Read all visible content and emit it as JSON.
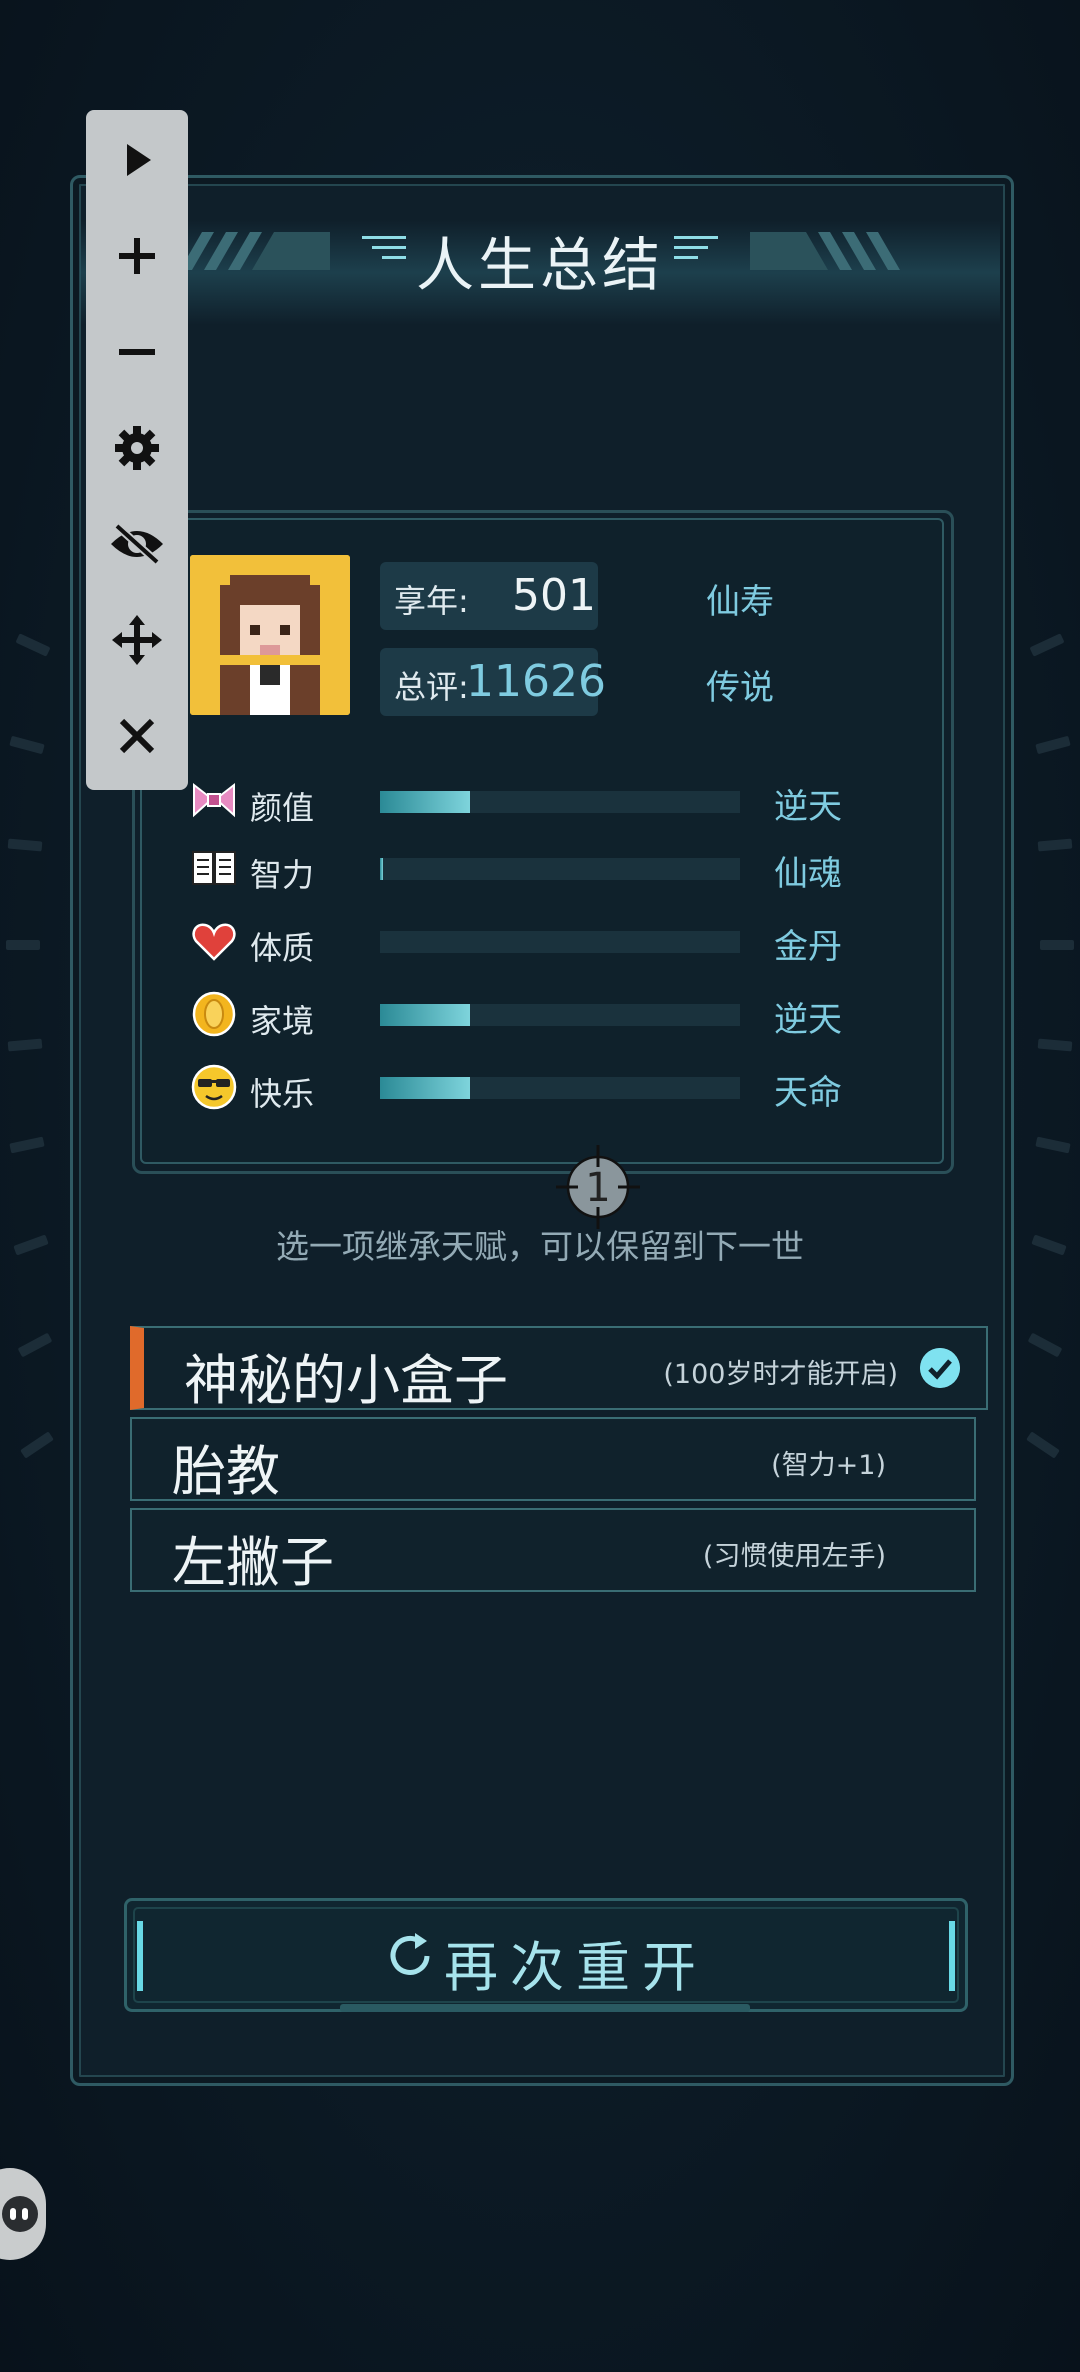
{
  "title": "人生总结",
  "summary": {
    "age_label": "享年:",
    "age_value": "501",
    "age_grade": "仙寿",
    "score_label": "总评:",
    "score_value": "11626",
    "score_grade": "传说"
  },
  "attributes": [
    {
      "name": "颜值",
      "grade": "逆天",
      "icon": "bow-icon",
      "fill": 0.25
    },
    {
      "name": "智力",
      "grade": "仙魂",
      "icon": "book-icon",
      "fill": 0.01
    },
    {
      "name": "体质",
      "grade": "金丹",
      "icon": "heart-icon",
      "fill": 0.0
    },
    {
      "name": "家境",
      "grade": "逆天",
      "icon": "coin-icon",
      "fill": 0.25
    },
    {
      "name": "快乐",
      "grade": "天命",
      "icon": "sunglasses-face-icon",
      "fill": 0.25
    }
  ],
  "crosshair_label": "1",
  "hint": "选一项继承天赋，可以保留到下一世",
  "talents": [
    {
      "name": "神秘的小盒子",
      "desc": "(100岁时才能开启)",
      "selected": true
    },
    {
      "name": "胎教",
      "desc": "(智力+1)",
      "selected": false
    },
    {
      "name": "左撇子",
      "desc": "(习惯使用左手)",
      "selected": false
    }
  ],
  "restart_label": "再次重开",
  "toolbar": [
    "play-icon",
    "plus-icon",
    "minus-icon",
    "gear-icon",
    "eye-off-icon",
    "move-icon",
    "close-icon"
  ],
  "colors": {
    "accent": "#7fcbe0",
    "selected_marker": "#e06a2b",
    "bar_fill": "#7ed4dc"
  }
}
